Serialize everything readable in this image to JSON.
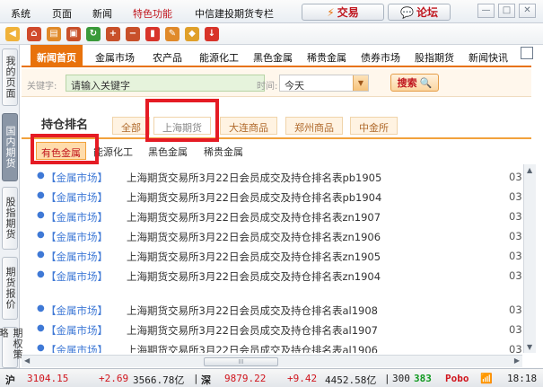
{
  "menubar": {
    "items": [
      "系统",
      "页面",
      "新闻",
      "特色功能",
      "中信建投期货专栏"
    ],
    "trade_label": "交易",
    "forum_label": "论坛"
  },
  "sidebar": {
    "tabs": [
      "我的页面",
      "国内期货",
      "股指期货",
      "期货报价",
      "期权策略"
    ]
  },
  "nav": {
    "tabs": [
      "新闻首页",
      "金属市场",
      "农产品",
      "能源化工",
      "黑色金属",
      "稀贵金属",
      "债券市场",
      "股指期货",
      "新闻快讯"
    ]
  },
  "search": {
    "keyword_label": "关键字:",
    "keyword_value": "请输入关键字",
    "time_label": "时间:",
    "time_value": "今天",
    "search_label": "搜索"
  },
  "rank": {
    "title": "持仓排名",
    "exchanges": [
      "全部",
      "上海期货",
      "大连商品",
      "郑州商品",
      "中金所"
    ],
    "subcategories": [
      "有色金属",
      "能源化工",
      "黑色金属",
      "稀贵金属"
    ]
  },
  "news": [
    {
      "category": "【金属市场】",
      "title": "上海期货交易所3月22日会员成交及持仓排名表pb1905",
      "date": "03"
    },
    {
      "category": "【金属市场】",
      "title": "上海期货交易所3月22日会员成交及持仓排名表pb1904",
      "date": "03"
    },
    {
      "category": "【金属市场】",
      "title": "上海期货交易所3月22日会员成交及持仓排名表zn1907",
      "date": "03"
    },
    {
      "category": "【金属市场】",
      "title": "上海期货交易所3月22日会员成交及持仓排名表zn1906",
      "date": "03"
    },
    {
      "category": "【金属市场】",
      "title": "上海期货交易所3月22日会员成交及持仓排名表zn1905",
      "date": "03"
    },
    {
      "category": "【金属市场】",
      "title": "上海期货交易所3月22日会员成交及持仓排名表zn1904",
      "date": "03"
    },
    {
      "category": "【金属市场】",
      "title": "上海期货交易所3月22日会员成交及持仓排名表al1908",
      "date": "03"
    },
    {
      "category": "【金属市场】",
      "title": "上海期货交易所3月22日会员成交及持仓排名表al1907",
      "date": "03"
    },
    {
      "category": "【金属市场】",
      "title": "上海期货交易所3月22日会员成交及持仓排名表al1906",
      "date": "03"
    }
  ],
  "scrollbar": {
    "thumb_label": "III"
  },
  "status": {
    "sh_label": "沪",
    "sh_index": "3104.15",
    "sh_change": "+2.69",
    "sh_amount": "3566.78亿",
    "sz_label": "深",
    "sz_index": "9879.22",
    "sz_change": "+9.42",
    "sz_amount": "4452.58亿",
    "hs_label": "300",
    "hs_value": "383",
    "brand": "Pobo",
    "time": "18:18"
  },
  "colors": {
    "accent": "#e8720c",
    "link": "#3f79d6",
    "highlight": "#e51b24",
    "up": "#d0141c"
  }
}
